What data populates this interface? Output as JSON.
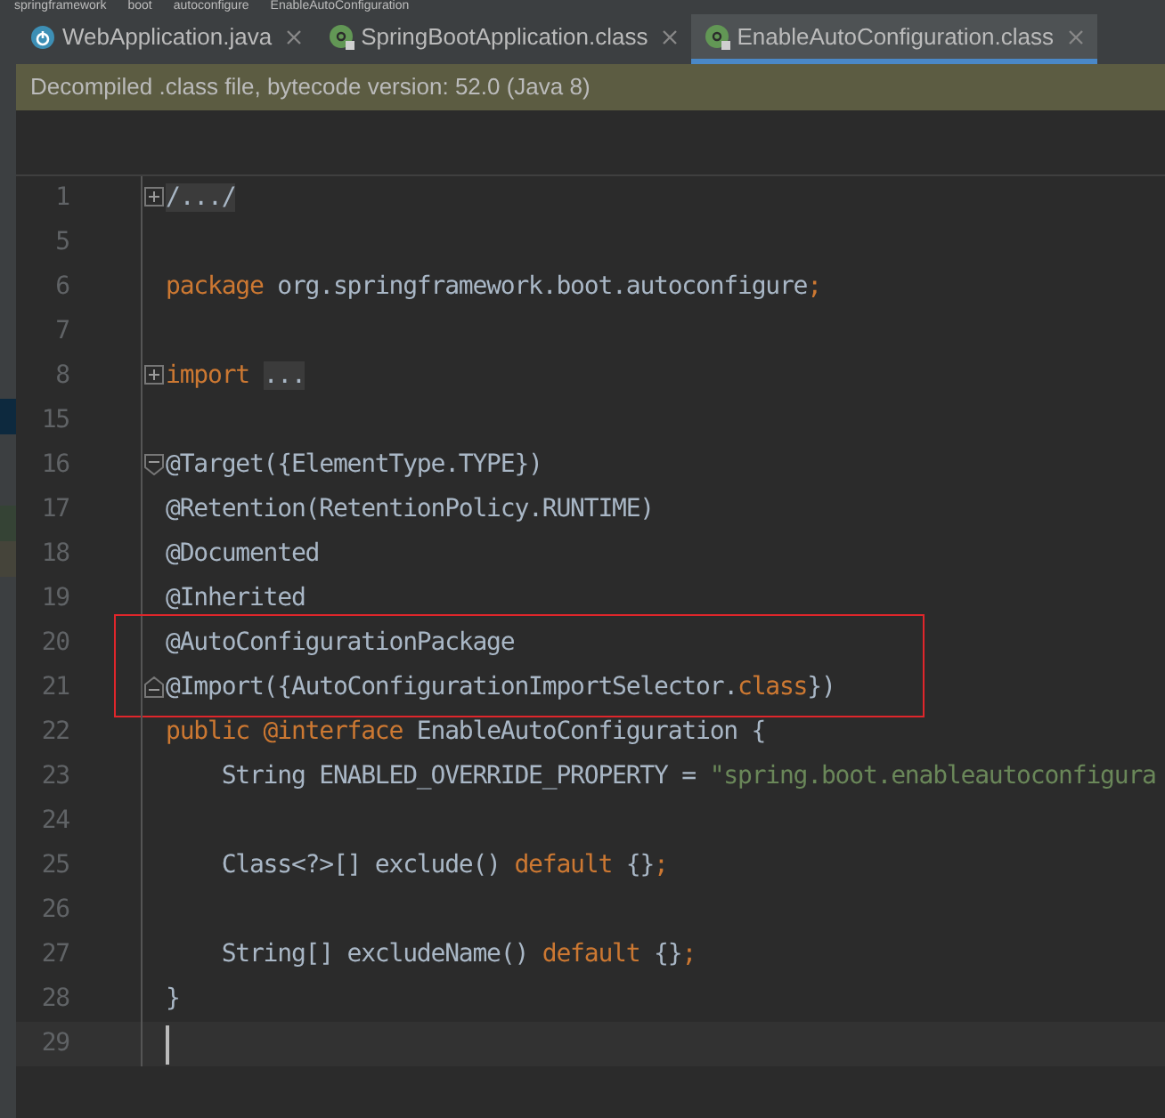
{
  "breadcrumb": [
    "springframework",
    "boot",
    "autoconfigure",
    "EnableAutoConfiguration"
  ],
  "tabs": [
    {
      "label": "WebApplication.java",
      "kind": "app",
      "selected": false
    },
    {
      "label": "SpringBootApplication.class",
      "kind": "annotation",
      "selected": false
    },
    {
      "label": "EnableAutoConfiguration.class",
      "kind": "annotation",
      "selected": true
    }
  ],
  "notice": "Decompiled .class file, bytecode version: 52.0 (Java 8)",
  "lines": [
    {
      "number": "1",
      "kind": "collapsed",
      "tokens": [
        {
          "text": "/.../",
          "kind": "folded"
        }
      ]
    },
    {
      "number": "5"
    },
    {
      "number": "6",
      "tokens": [
        {
          "text": "package",
          "kind": "keyword"
        },
        {
          "text": " org.springframework.boot.autoconfigure",
          "kind": "plain"
        },
        {
          "text": ";",
          "kind": "keyword"
        }
      ]
    },
    {
      "number": "7"
    },
    {
      "number": "8",
      "kind": "collapsed",
      "tokens": [
        {
          "text": "import ",
          "kind": "keyword"
        },
        {
          "text": "...",
          "kind": "folded"
        }
      ]
    },
    {
      "number": "15"
    },
    {
      "number": "16",
      "kind": "foldstart",
      "tokens": [
        {
          "text": "@Target({ElementType.TYPE})",
          "kind": "plain"
        }
      ]
    },
    {
      "number": "17",
      "tokens": [
        {
          "text": "@Retention(RetentionPolicy.RUNTIME)",
          "kind": "plain"
        }
      ]
    },
    {
      "number": "18",
      "tokens": [
        {
          "text": "@Documented",
          "kind": "plain"
        }
      ]
    },
    {
      "number": "19",
      "tokens": [
        {
          "text": "@Inherited",
          "kind": "plain"
        }
      ]
    },
    {
      "number": "20",
      "boxed": true,
      "tokens": [
        {
          "text": "@AutoConfigurationPackage",
          "kind": "plain"
        }
      ]
    },
    {
      "number": "21",
      "boxed": true,
      "kind": "foldend",
      "tokens": [
        {
          "text": "@Import({AutoConfigurationImportSelector.",
          "kind": "plain"
        },
        {
          "text": "class",
          "kind": "keyword"
        },
        {
          "text": "})",
          "kind": "plain"
        }
      ]
    },
    {
      "number": "22",
      "tokens": [
        {
          "text": "public @interface",
          "kind": "keyword"
        },
        {
          "text": " EnableAutoConfiguration {",
          "kind": "plain"
        }
      ]
    },
    {
      "number": "23",
      "tokens": [
        {
          "text": "    String ENABLED_OVERRIDE_PROPERTY = ",
          "kind": "plain"
        },
        {
          "text": "\"spring.boot.enableautoconfigura",
          "kind": "string"
        }
      ]
    },
    {
      "number": "24"
    },
    {
      "number": "25",
      "tokens": [
        {
          "text": "    Class<?>[] exclude() ",
          "kind": "plain"
        },
        {
          "text": "default",
          "kind": "keyword"
        },
        {
          "text": " {}",
          "kind": "plain"
        },
        {
          "text": ";",
          "kind": "keyword"
        }
      ]
    },
    {
      "number": "26"
    },
    {
      "number": "27",
      "tokens": [
        {
          "text": "    String[] excludeName() ",
          "kind": "plain"
        },
        {
          "text": "default",
          "kind": "keyword"
        },
        {
          "text": " {}",
          "kind": "plain"
        },
        {
          "text": ";",
          "kind": "keyword"
        }
      ]
    },
    {
      "number": "28",
      "tokens": [
        {
          "text": "}",
          "kind": "plain"
        }
      ]
    },
    {
      "number": "29",
      "current": true
    }
  ]
}
